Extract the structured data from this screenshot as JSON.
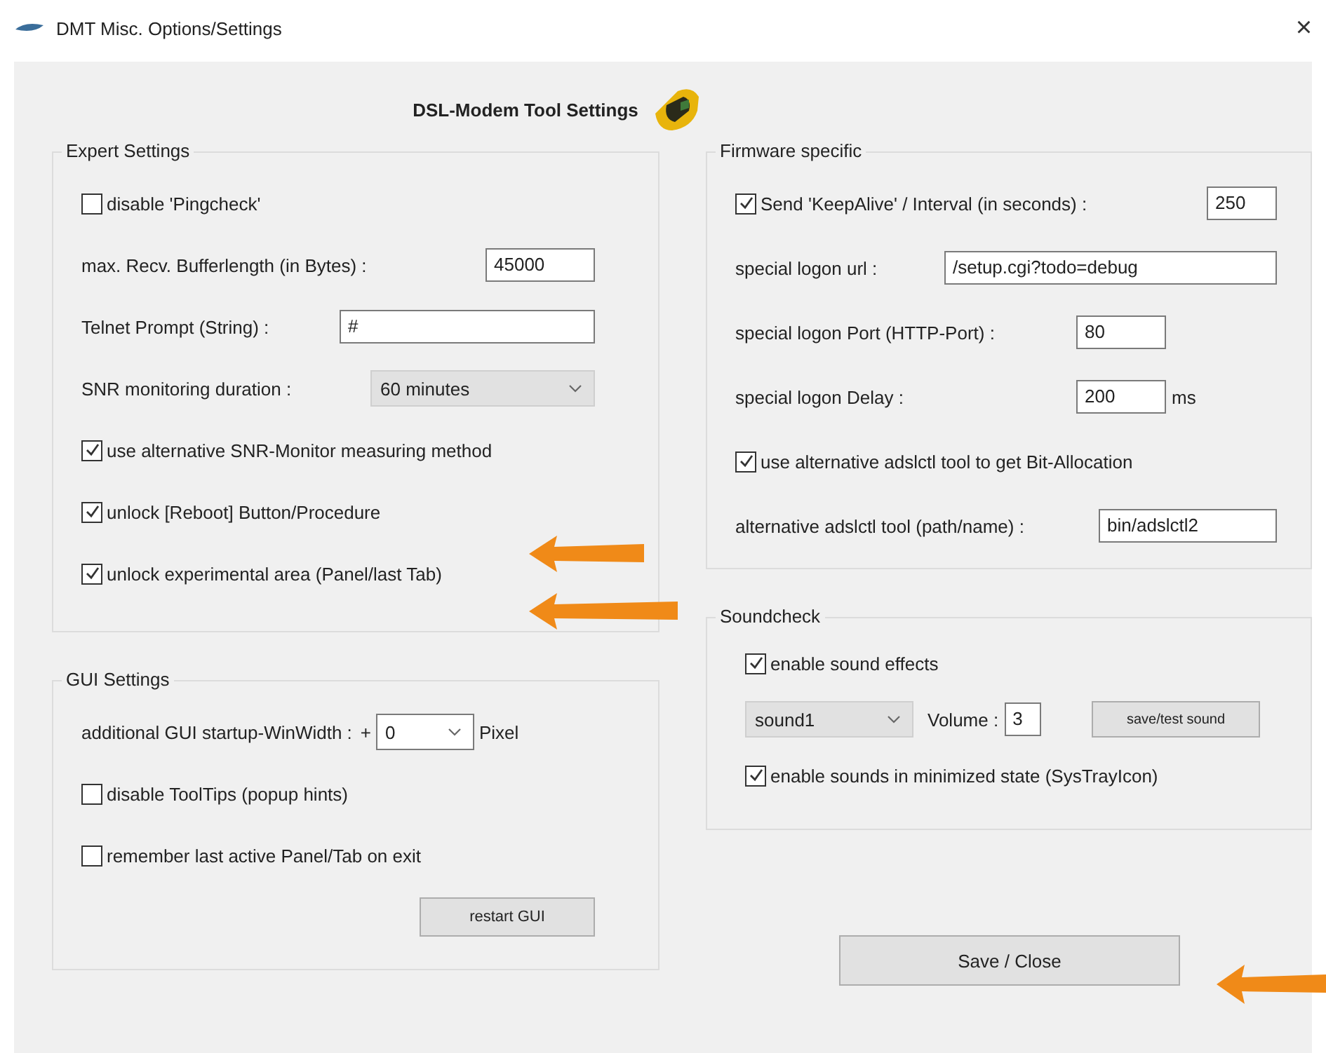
{
  "window": {
    "title": "DMT Misc. Options/Settings",
    "close": "×"
  },
  "header": {
    "title": "DSL-Modem Tool Settings"
  },
  "expert": {
    "title": "Expert Settings",
    "rows": [
      {
        "kind": "checkbox",
        "label": "disable 'Pingcheck'",
        "checked": false
      },
      {
        "kind": "field",
        "label": "max. Recv. Bufferlength  (in Bytes) :",
        "value": "45000"
      },
      {
        "kind": "field",
        "label": "Telnet Prompt (String) :",
        "value": "#"
      },
      {
        "kind": "dropdown",
        "label": "SNR monitoring duration :",
        "value": "60 minutes",
        "editable": false
      },
      {
        "kind": "checkbox",
        "label": "use alternative SNR-Monitor measuring method",
        "checked": true
      },
      {
        "kind": "checkbox",
        "label": "unlock [Reboot] Button/Procedure",
        "checked": true
      },
      {
        "kind": "checkbox",
        "label": "unlock experimental area (Panel/last Tab)",
        "checked": true
      }
    ]
  },
  "gui": {
    "title": "GUI Settings",
    "rows": [
      {
        "kind": "dropdown",
        "label": "additional GUI startup-WinWidth :",
        "prefix": "+",
        "value": "0",
        "unit": "Pixel",
        "editable": true
      },
      {
        "kind": "checkbox",
        "label": "disable ToolTips (popup hints)",
        "checked": false
      },
      {
        "kind": "checkbox",
        "label": "remember last active Panel/Tab on exit",
        "checked": false
      }
    ],
    "button": "restart GUI"
  },
  "firmware": {
    "title": "Firmware specific",
    "rows": [
      {
        "kind": "field",
        "checked": true,
        "label": "Send 'KeepAlive' / Interval (in seconds) :",
        "value": "250"
      },
      {
        "kind": "field",
        "label": "special logon url :",
        "value": "/setup.cgi?todo=debug"
      },
      {
        "kind": "field",
        "label": "special logon Port (HTTP-Port) :",
        "value": "80"
      },
      {
        "kind": "field",
        "label": "special logon Delay :",
        "value": "200",
        "unit": "ms"
      },
      {
        "kind": "checkbox",
        "label": "use alternative adslctl tool to get Bit-Allocation",
        "checked": true
      },
      {
        "kind": "field",
        "label": "alternative adslctl tool (path/name) :",
        "value": "bin/adslctl2"
      }
    ]
  },
  "soundcheck": {
    "title": "Soundcheck",
    "rows": [
      {
        "kind": "checkbox",
        "label": "enable sound effects",
        "checked": true
      },
      {
        "kind": "sound_controls",
        "sound": "sound1",
        "volume_label": "Volume :",
        "volume": "3",
        "button": "save/test sound"
      },
      {
        "kind": "checkbox",
        "label": "enable sounds in minimized state (SysTrayIcon)",
        "checked": true
      }
    ]
  },
  "save_button": "Save / Close"
}
